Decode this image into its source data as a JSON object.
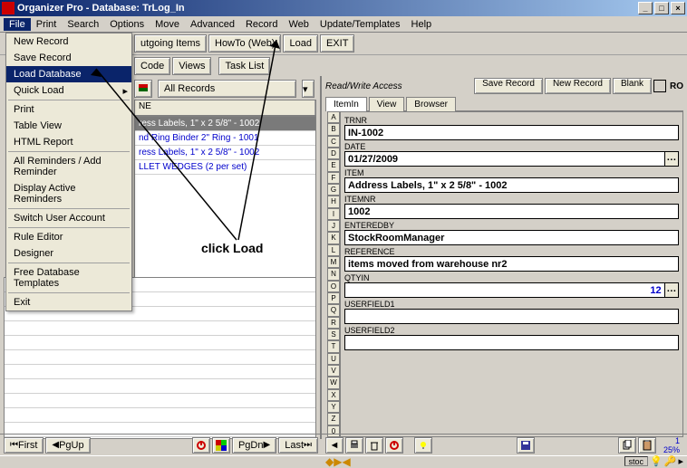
{
  "window": {
    "title": "Organizer Pro - Database: TrLog_In"
  },
  "menubar": [
    "File",
    "Print",
    "Search",
    "Options",
    "Move",
    "Advanced",
    "Record",
    "Web",
    "Update/Templates",
    "Help"
  ],
  "toolbar1": {
    "outgoing": "utgoing Items",
    "howto": "HowTo (Web)",
    "load": "Load",
    "exit": "EXIT"
  },
  "toolbar2": {
    "code": "Code",
    "views": "Views",
    "tasklist": "Task List",
    "allrecords": "All Records"
  },
  "file_menu": {
    "new_record": "New Record",
    "save_record": "Save Record",
    "load_database": "Load Database",
    "quick_load": "Quick Load",
    "print": "Print",
    "table_view": "Table View",
    "html_report": "HTML Report",
    "all_reminders": "All Reminders / Add Reminder",
    "display_reminders": "Display Active Reminders",
    "switch_user": "Switch User Account",
    "rule_editor": "Rule Editor",
    "designer": "Designer",
    "free_templates": "Free Database Templates",
    "exit": "Exit"
  },
  "grid": {
    "header_col1": "NE",
    "rows": [
      {
        "text": "ress Labels, 1\" x 2 5/8\" - 1002",
        "sel": true
      },
      {
        "text": "nd Ring Binder 2\" Ring - 1001",
        "blue": true
      },
      {
        "text": "ress Labels, 1\" x 2 5/8\" - 1002",
        "blue": true
      },
      {
        "text": "LLET WEDGES (2 per set)",
        "blue": true
      }
    ]
  },
  "annotation": {
    "text": "click Load"
  },
  "right": {
    "rw_label": "Read/Write Access",
    "save": "Save Record",
    "new": "New Record",
    "blank": "Blank",
    "ro": "RO",
    "tabs": [
      "ItemIn",
      "View",
      "Browser"
    ],
    "letters": [
      "A",
      "B",
      "C",
      "D",
      "E",
      "F",
      "G",
      "H",
      "I",
      "J",
      "K",
      "L",
      "M",
      "N",
      "O",
      "P",
      "Q",
      "R",
      "S",
      "T",
      "U",
      "V",
      "W",
      "X",
      "Y",
      "Z",
      "0"
    ],
    "fields": {
      "trnr_label": "TRNR",
      "trnr": "IN-1002",
      "date_label": "DATE",
      "date": "01/27/2009",
      "item_label": "ITEM",
      "item": "Address Labels, 1\" x 2 5/8\" - 1002",
      "itemnr_label": "ITEMNR",
      "itemnr": "1002",
      "enteredby_label": "ENTEREDBY",
      "enteredby": "StockRoomManager",
      "reference_label": "REFERENCE",
      "reference": "items moved from warehouse nr2",
      "qtyin_label": "QTYIN",
      "qtyin": "12",
      "uf1_label": "USERFIELD1",
      "uf1": "",
      "uf2_label": "USERFIELD2",
      "uf2": ""
    }
  },
  "nav": {
    "first": "First",
    "pgup": "PgUp",
    "pgdn": "PgDn",
    "last": "Last"
  },
  "status": {
    "stoc": "stoc",
    "pct": "25%",
    "one": "1"
  }
}
